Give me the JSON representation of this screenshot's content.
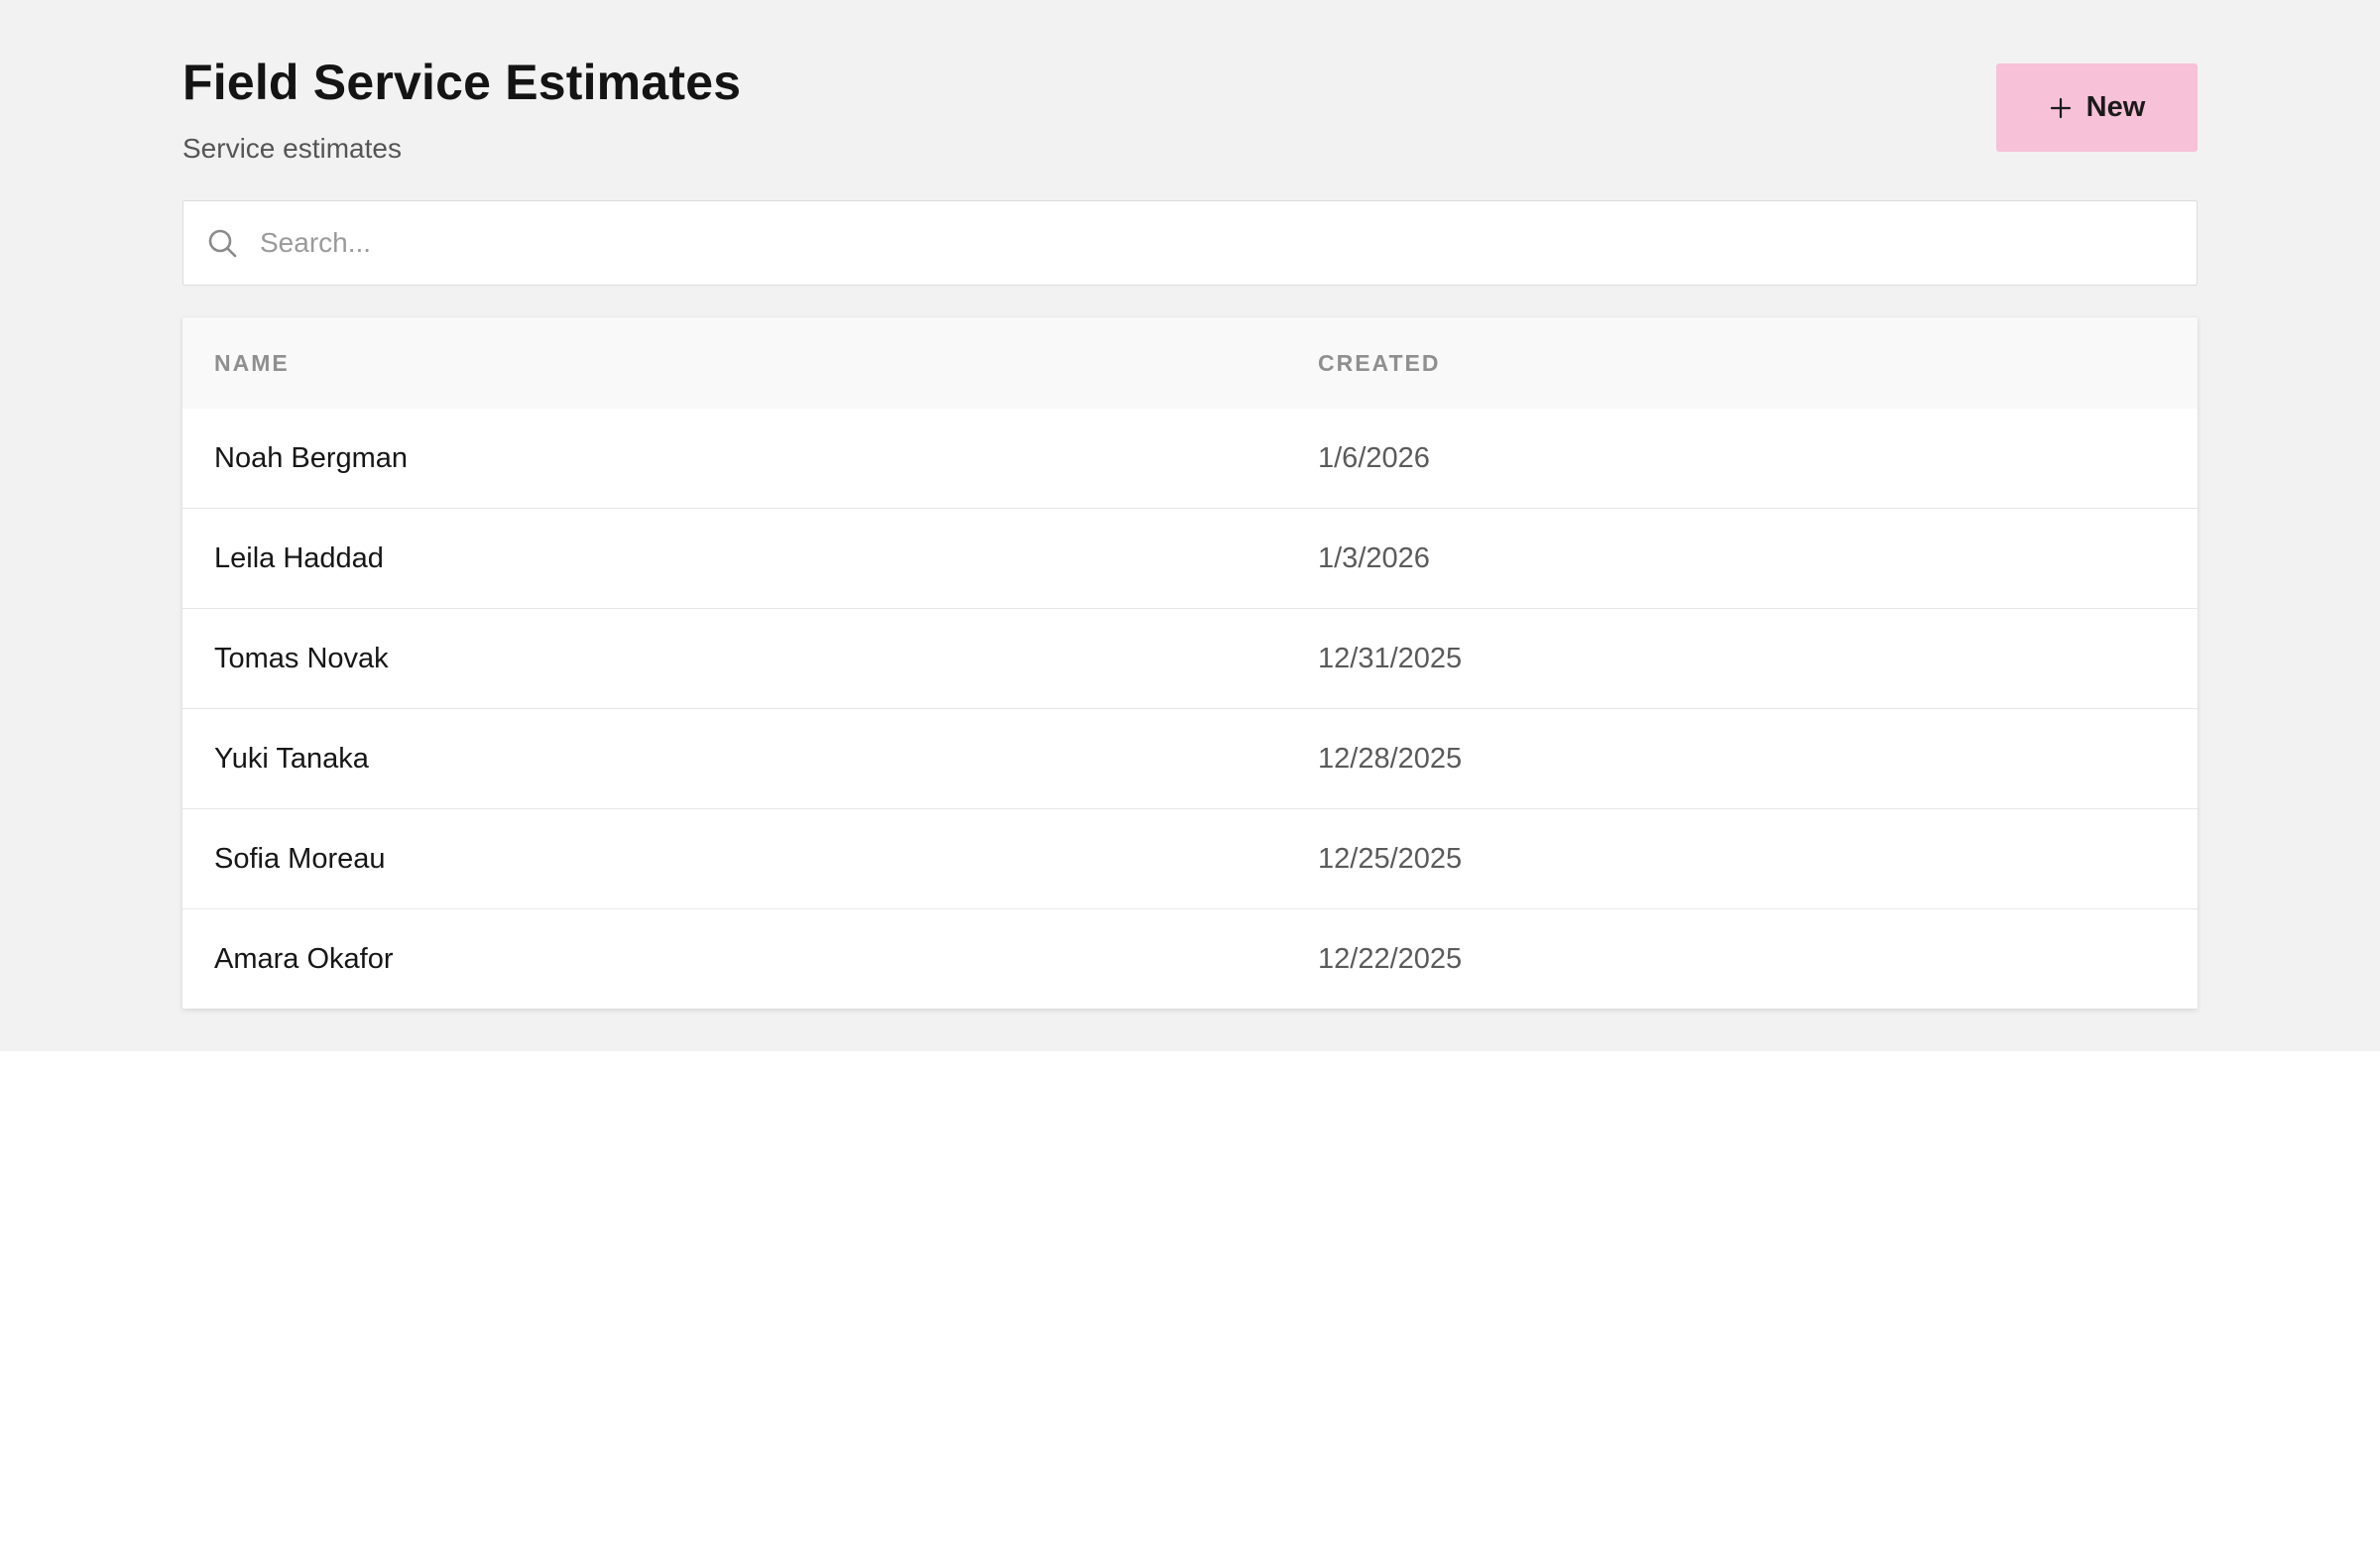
{
  "header": {
    "title": "Field Service Estimates",
    "subtitle": "Service estimates",
    "new_button_label": "New",
    "new_button_icon": "plus-icon",
    "new_button_color": "#f7c1d7"
  },
  "search": {
    "placeholder": "Search...",
    "value": "",
    "icon": "search-icon"
  },
  "table": {
    "columns": [
      "NAME",
      "CREATED"
    ],
    "rows": [
      {
        "name": "Noah Bergman",
        "created": "1/6/2026"
      },
      {
        "name": "Leila Haddad",
        "created": "1/3/2026"
      },
      {
        "name": "Tomas Novak",
        "created": "12/31/2025"
      },
      {
        "name": "Yuki Tanaka",
        "created": "12/28/2025"
      },
      {
        "name": "Sofia Moreau",
        "created": "12/25/2025"
      },
      {
        "name": "Amara Okafor",
        "created": "12/22/2025"
      }
    ]
  }
}
